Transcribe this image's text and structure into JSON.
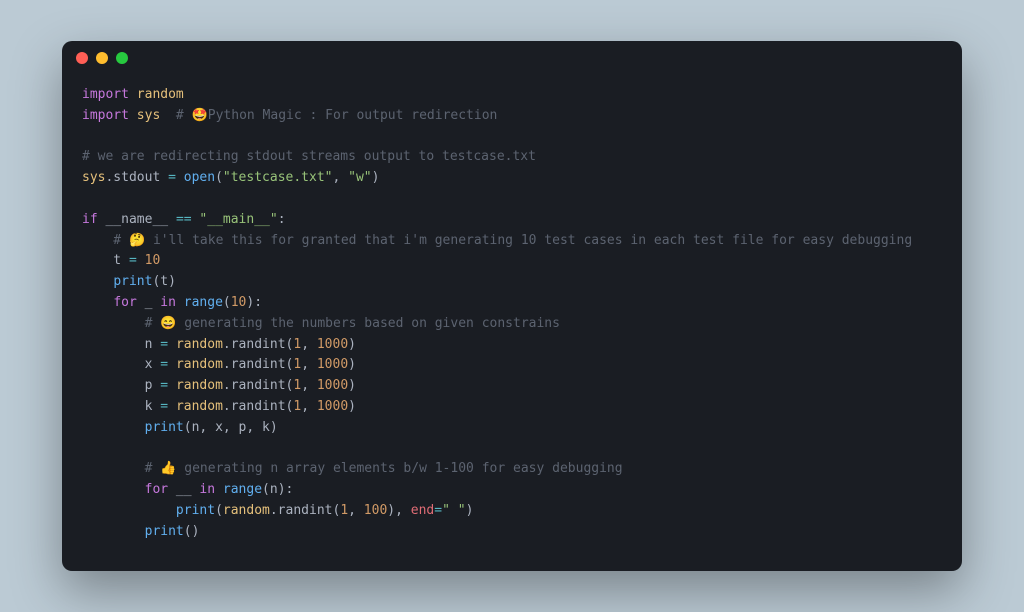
{
  "titlebar": {
    "buttons": [
      "close",
      "minimize",
      "zoom"
    ]
  },
  "code": {
    "l1_import": "import",
    "l1_random": "random",
    "l2_import": "import",
    "l2_sys": "sys",
    "l2_comment": "  # 🤩Python Magic : For output redirection",
    "l3_blank": "",
    "l4_comment": "# we are redirecting stdout streams output to testcase.txt",
    "l5_sys": "sys",
    "l5_stdout": ".stdout",
    "l5_eq": " = ",
    "l5_open": "open",
    "l5_args_s1": "\"testcase.txt\"",
    "l5_args_s2": "\"w\"",
    "l6_blank": "",
    "l7_if": "if",
    "l7_name": " __name__ ",
    "l7_eq": "==",
    "l7_main": " \"__main__\"",
    "l7_colon": ":",
    "l8_comment": "    # 🤔 i'll take this for granted that i'm generating 10 test cases in each test file for easy debugging",
    "l9_t": "    t",
    "l9_eq": " = ",
    "l9_10": "10",
    "l10_print": "print",
    "l10_t": "(t)",
    "l11_for": "for",
    "l11_u": " _ ",
    "l11_in": "in",
    "l11_range": " range",
    "l11_10": "10",
    "l12_comment": "        # 😄 generating the numbers based on given constrains",
    "l13_n": "        n",
    "l13_eq": " = ",
    "l13_rand": "random",
    "l13_randint": ".randint(",
    "l13_a": "1",
    "l13_b": "1000",
    "l14_x": "        x",
    "l15_p": "        p",
    "l16_k": "        k",
    "l17_print": "print",
    "l17_args": "(n, x, p, k)",
    "l18_blank": "",
    "l19_comment": "        # 👍 generating n array elements b/w 1-100 for easy debugging",
    "l20_for": "for",
    "l20_uu": " __ ",
    "l20_in": "in",
    "l20_range": " range",
    "l20_n": "(n):",
    "l21_print": "print",
    "l21_rand": "random",
    "l21_randint": ".randint(",
    "l21_a": "1",
    "l21_b": "100",
    "l21_end": "end",
    "l21_sp": "\" \"",
    "l22_print": "print",
    "l22_p": "()"
  }
}
